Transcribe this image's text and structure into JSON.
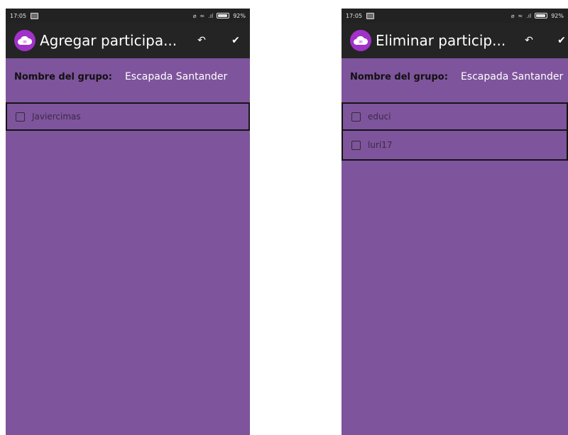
{
  "screens": [
    {
      "status": {
        "time": "17:05",
        "battery": "92%",
        "battery_level": 0.92
      },
      "appbar": {
        "title": "Agregar participa...",
        "back_icon": "undo-arrow-icon",
        "confirm_icon": "checkmark-icon"
      },
      "group": {
        "label": "Nombre del grupo:",
        "value": "Escapada Santander"
      },
      "items": [
        {
          "label": "Javiercimas",
          "checked": false
        }
      ]
    },
    {
      "status": {
        "time": "17:05",
        "battery": "92%",
        "battery_level": 0.92
      },
      "appbar": {
        "title": "Eliminar particip...",
        "back_icon": "undo-arrow-icon",
        "confirm_icon": "checkmark-icon"
      },
      "group": {
        "label": "Nombre del grupo:",
        "value": "Escapada Santander"
      },
      "items": [
        {
          "label": "educi",
          "checked": false
        },
        {
          "label": "luri17",
          "checked": false
        }
      ]
    }
  ],
  "colors": {
    "background": "#7e549c",
    "appbar": "#242424",
    "logo": "#a032c8"
  }
}
